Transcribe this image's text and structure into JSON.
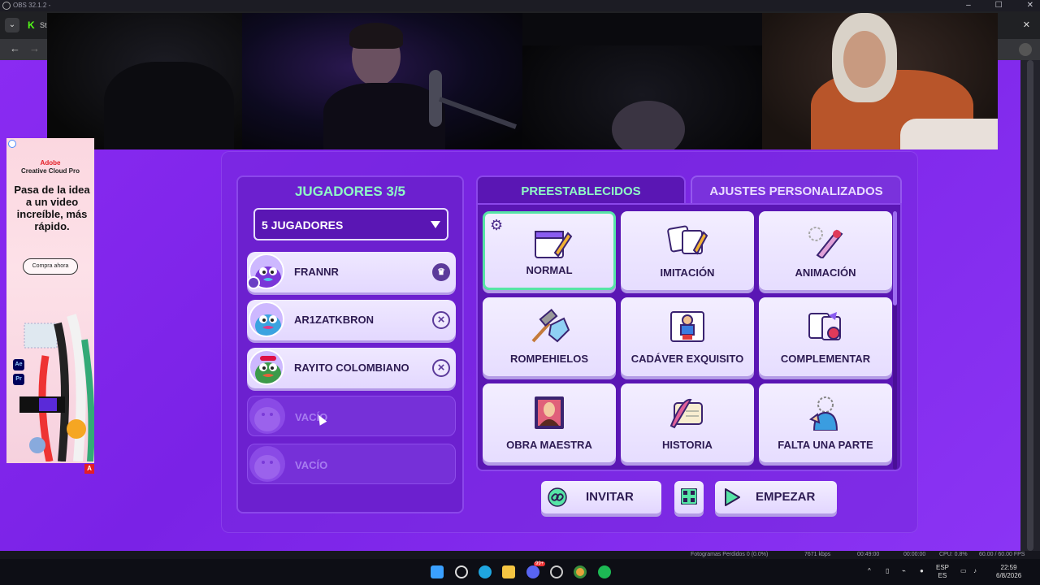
{
  "obs": {
    "title": "OBS 32.1.2 -",
    "status_dropped": "Fotogramas Perdidos 0 (0.0%)",
    "status_kbps": "7671 kbps",
    "status_time1": "00:49:00",
    "status_time2": "00:00:00",
    "status_cpu": "CPU: 0.8%",
    "status_fps": "60.00 / 60.00 FPS"
  },
  "browser": {
    "tab_text": "St"
  },
  "ad": {
    "brand_line1": "Adobe",
    "brand_line2": "Creative Cloud Pro",
    "headline": "Pasa de la idea a un video increíble, más rápido.",
    "cta": "Compra ahora",
    "apps": [
      "Ae",
      "Pr"
    ],
    "corner_logo": "A"
  },
  "players": {
    "title": "JUGADORES 3/5",
    "select_value": "5 JUGADORES",
    "list": [
      {
        "name": "FRANNR",
        "action": "crown-icon",
        "state": "host"
      },
      {
        "name": "AR1ZATKBRON",
        "action": "×",
        "state": "player"
      },
      {
        "name": "RAYITO COLOMBIANO",
        "action": "×",
        "state": "player"
      },
      {
        "name": "VACÍO",
        "state": "empty"
      },
      {
        "name": "VACÍO",
        "state": "empty"
      }
    ]
  },
  "tabs": {
    "presets": "PREESTABLECIDOS",
    "custom": "AJUSTES PERSONALIZADOS"
  },
  "presets": [
    {
      "label": "NORMAL",
      "icon": "notebook-pencil-icon",
      "selected": true
    },
    {
      "label": "IMITACIÓN",
      "icon": "copy-cards-icon"
    },
    {
      "label": "ANIMACIÓN",
      "icon": "animation-pencil-icon"
    },
    {
      "label": "ROMPEHIELOS",
      "icon": "hammer-ice-icon"
    },
    {
      "label": "CADÁVER EXQUISITO",
      "icon": "exquisite-corpse-icon"
    },
    {
      "label": "COMPLEMENTAR",
      "icon": "puzzle-complement-icon"
    },
    {
      "label": "OBRA MAESTRA",
      "icon": "masterpiece-portrait-icon"
    },
    {
      "label": "HISTORIA",
      "icon": "scroll-quill-icon"
    },
    {
      "label": "FALTA UNA PARTE",
      "icon": "missing-part-icon"
    }
  ],
  "buttons": {
    "invite": "INVITAR",
    "start": "EMPEZAR"
  },
  "taskbar": {
    "lang1": "ESP",
    "lang2": "ES",
    "time": "22:59",
    "date": "6/8/2026",
    "badge": "99+"
  },
  "colors": {
    "page": "#8a2bf2",
    "accent_green": "#8ff7c6",
    "selected_border": "#56e4a6",
    "card": "#efe8ff"
  }
}
